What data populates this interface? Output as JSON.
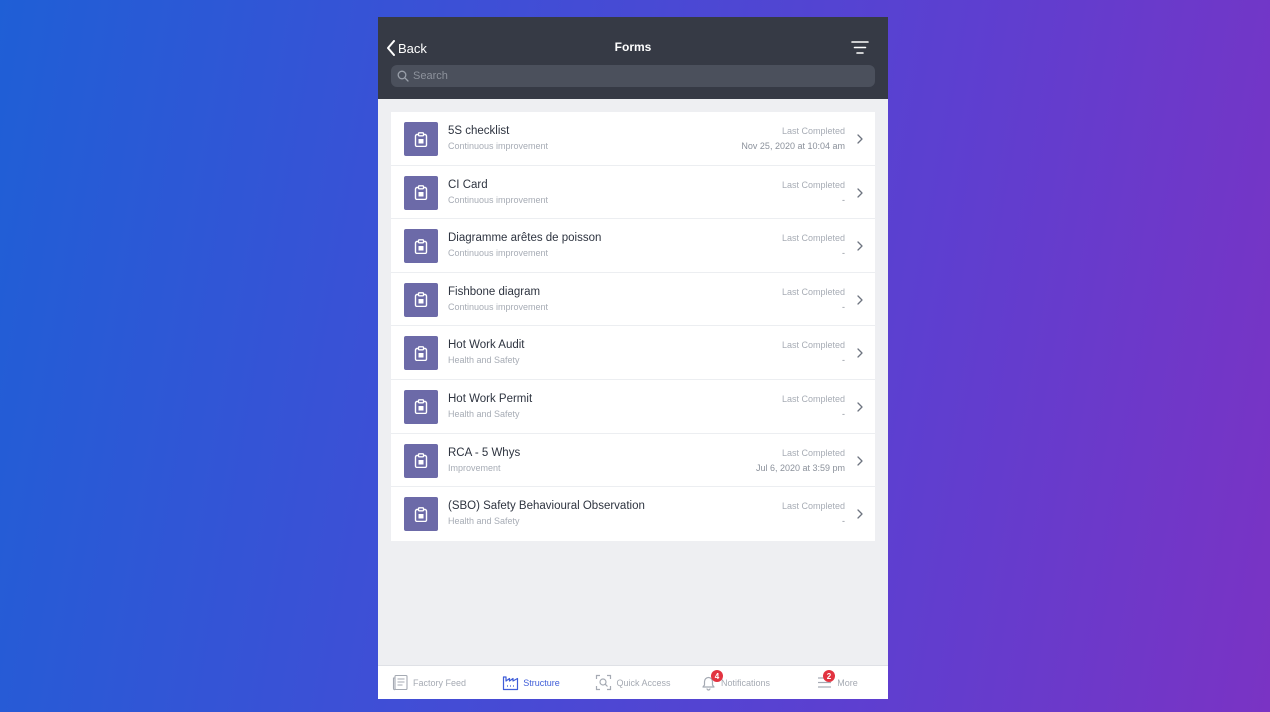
{
  "header": {
    "back_label": "Back",
    "title": "Forms",
    "search_placeholder": "Search"
  },
  "forms": [
    {
      "name": "5S checklist",
      "category": "Continuous improvement",
      "last_label": "Last Completed",
      "last_value": "Nov 25, 2020 at 10:04 am"
    },
    {
      "name": "CI Card",
      "category": "Continuous improvement",
      "last_label": "Last Completed",
      "last_value": "-"
    },
    {
      "name": "Diagramme arêtes de poisson",
      "category": "Continuous improvement",
      "last_label": "Last Completed",
      "last_value": "-"
    },
    {
      "name": "Fishbone diagram",
      "category": "Continuous improvement",
      "last_label": "Last Completed",
      "last_value": "-"
    },
    {
      "name": "Hot Work Audit",
      "category": "Health and Safety",
      "last_label": "Last Completed",
      "last_value": "-"
    },
    {
      "name": "Hot Work Permit",
      "category": "Health and Safety",
      "last_label": "Last Completed",
      "last_value": "-"
    },
    {
      "name": "RCA - 5 Whys",
      "category": "Improvement",
      "last_label": "Last Completed",
      "last_value": "Jul 6, 2020 at 3:59 pm"
    },
    {
      "name": "(SBO) Safety Behavioural Observation",
      "category": "Health and Safety",
      "last_label": "Last Completed",
      "last_value": "-"
    }
  ],
  "tabbar": {
    "factory_feed": "Factory Feed",
    "structure": "Structure",
    "quick_access": "Quick Access",
    "notifications": "Notifications",
    "notifications_badge": "4",
    "more": "More",
    "more_badge": "2"
  },
  "colors": {
    "accent": "#3f5dd8",
    "header_bg": "#363a45",
    "form_icon_bg": "#6c6aa8",
    "badge": "#e23340"
  }
}
